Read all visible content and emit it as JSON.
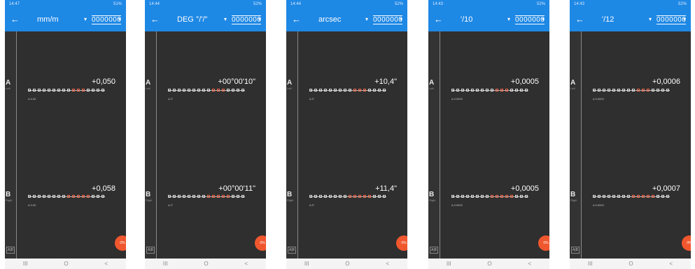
{
  "phones": [
    {
      "status_time": "14:47",
      "status_right": "51%",
      "unit": "mm/m",
      "resolution": "0000000",
      "channel_a": {
        "letter": "A",
        "sub": "Left",
        "value": "+0,050",
        "delta": "Δ 0.02"
      },
      "channel_b": {
        "letter": "B",
        "sub": "Right",
        "value": "+0,058",
        "delta": "Δ 0.02"
      },
      "a_b_label": "A|B",
      "fab_label": "0%"
    },
    {
      "status_time": "14:44",
      "status_right": "52%",
      "unit": "DEG °/'/\"",
      "resolution": "0000000",
      "channel_a": {
        "letter": "A",
        "sub": "Left",
        "value": "+00°00'10\"",
        "delta": "Δ 2\""
      },
      "channel_b": {
        "letter": "B",
        "sub": "Right",
        "value": "+00°00'11\"",
        "delta": "Δ 2\""
      },
      "a_b_label": "A|B",
      "fab_label": "0%"
    },
    {
      "status_time": "14:44",
      "status_right": "52%",
      "unit": "arcsec",
      "resolution": "0000000",
      "channel_a": {
        "letter": "A",
        "sub": "Left",
        "value": "+10,4\"",
        "delta": "Δ 0\""
      },
      "channel_b": {
        "letter": "B",
        "sub": "Right",
        "value": "+11,4\"",
        "delta": "Δ 0\""
      },
      "a_b_label": "A|B",
      "fab_label": "0%"
    },
    {
      "status_time": "14:43",
      "status_right": "52%",
      "unit": "'/10",
      "resolution": "0000000",
      "channel_a": {
        "letter": "A",
        "sub": "Left",
        "value": "+0,0005",
        "delta": "Δ 0.0002"
      },
      "channel_b": {
        "letter": "B",
        "sub": "Right",
        "value": "+0,0005",
        "delta": "Δ 0.0002"
      },
      "a_b_label": "A|B",
      "fab_label": "0%"
    },
    {
      "status_time": "14:43",
      "status_right": "52%",
      "unit": "'/12",
      "resolution": "0000000",
      "channel_a": {
        "letter": "A",
        "sub": "Left",
        "value": "+0,0006",
        "delta": "Δ 0.0002"
      },
      "channel_b": {
        "letter": "B",
        "sub": "Right",
        "value": "+0,0007",
        "delta": "Δ 0.0002"
      },
      "a_b_label": "A|B",
      "fab_label": "0%"
    }
  ],
  "nav": {
    "recents": "III",
    "home": "O",
    "back": "<"
  },
  "icons": {
    "back": "arrow-left-icon",
    "caret": "caret-down-icon"
  },
  "colors": {
    "appbar": "#1e88e5",
    "fab": "#f0572e",
    "screen": "#2f2f2f"
  }
}
